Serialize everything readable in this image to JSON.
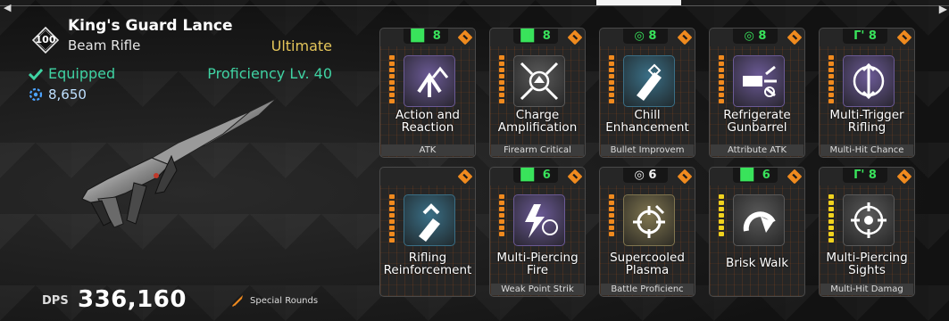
{
  "weapon": {
    "rank": "100",
    "name": "King's Guard Lance",
    "type": "Beam Rifle",
    "rarity": "Ultimate",
    "status": "Equipped",
    "proficiency": "Proficiency Lv. 40",
    "power": "8,650",
    "dps_label": "DPS",
    "dps_value": "336,160",
    "ammo_type": "Special Rounds"
  },
  "colors": {
    "green_accent": "#3fd3a3",
    "gold_rarity": "#e5c65a",
    "orange_tag": "#f08a1e",
    "capacity_green": "#39e35b"
  },
  "modules": [
    {
      "name_l1": "Action and",
      "name_l2": "Reaction",
      "tag": "ATK",
      "capacity": "8",
      "symbol": "bars",
      "cap_color": "green",
      "icon_bg": "#6b5a96",
      "icon": "arrows-up-icon",
      "bar_color": "#f08a1e",
      "bars": 8
    },
    {
      "name_l1": "Charge",
      "name_l2": "Amplification",
      "tag": "Firearm Critical",
      "capacity": "8",
      "symbol": "bars",
      "cap_color": "green",
      "icon_bg": "#5a5a5a",
      "icon": "converge-icon",
      "bar_color": "#f08a1e",
      "bars": 8
    },
    {
      "name_l1": "Chill",
      "name_l2": "Enhancement",
      "tag": "Bullet Improvem",
      "capacity": "8",
      "symbol": "c",
      "cap_color": "green",
      "icon_bg": "#3a6f86",
      "icon": "bullet-frost-icon",
      "bar_color": "#f08a1e",
      "bars": 8
    },
    {
      "name_l1": "Refrigerate",
      "name_l2": "Gunbarrel",
      "tag": "Attribute ATK",
      "capacity": "8",
      "symbol": "c",
      "cap_color": "green",
      "icon_bg": "#6b5a96",
      "icon": "frost-barrel-icon",
      "bar_color": "#f08a1e",
      "bars": 8
    },
    {
      "name_l1": "Multi-Trigger",
      "name_l2": "Rifling",
      "tag": "Multi-Hit Chance",
      "capacity": "8",
      "symbol": "r",
      "cap_color": "green",
      "icon_bg": "#6b5a96",
      "icon": "multi-arrows-icon",
      "bar_color": "#f08a1e",
      "bars": 8
    },
    {
      "name_l1": "Rifling",
      "name_l2": "Reinforcement",
      "tag": "",
      "capacity": "",
      "symbol": "none",
      "cap_color": "green",
      "icon_bg": "#3a6f86",
      "icon": "bullet-chevron-icon",
      "bar_color": "#f08a1e",
      "bars": 8
    },
    {
      "name_l1": "Multi-Piercing",
      "name_l2": "Fire",
      "tag": "Weak Point Strik",
      "capacity": "6",
      "symbol": "bars",
      "cap_color": "green",
      "icon_bg": "#6b5a96",
      "icon": "bolt-target-icon",
      "bar_color": "#f08a1e",
      "bars": 7
    },
    {
      "name_l1": "Supercooled",
      "name_l2": "Plasma",
      "tag": "Battle Proficienc",
      "capacity": "6",
      "symbol": "c",
      "cap_color": "white",
      "icon_bg": "#807650",
      "icon": "crosshair-icon",
      "bar_color": "#f08a1e",
      "bars": 7
    },
    {
      "name_l1": "Brisk Walk",
      "name_l2": "",
      "tag": "",
      "capacity": "6",
      "symbol": "bars",
      "cap_color": "green",
      "icon_bg": "#5a5a5a",
      "icon": "speed-icon",
      "bar_color": "#f0d21e",
      "bars": 7
    },
    {
      "name_l1": "Multi-Piercing",
      "name_l2": "Sights",
      "tag": "Multi-Hit Damag",
      "capacity": "8",
      "symbol": "r",
      "cap_color": "green",
      "icon_bg": "#5a5a5a",
      "icon": "target-arrows-icon",
      "bar_color": "#f0d21e",
      "bars": 8
    }
  ]
}
